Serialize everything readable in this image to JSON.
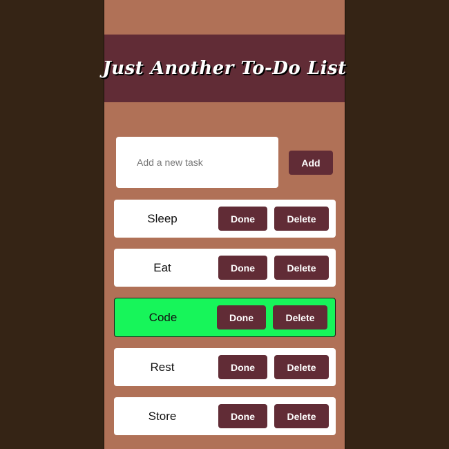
{
  "header": {
    "title": "Just Another To-Do List"
  },
  "new_task": {
    "placeholder": "Add a new task",
    "value": "",
    "add_label": "Add"
  },
  "todos": [
    {
      "text": "Sleep",
      "completed": false,
      "done_label": "Done",
      "delete_label": "Delete"
    },
    {
      "text": "Eat",
      "completed": false,
      "done_label": "Done",
      "delete_label": "Delete"
    },
    {
      "text": "Code",
      "completed": true,
      "done_label": "Done",
      "delete_label": "Delete"
    },
    {
      "text": "Rest",
      "completed": false,
      "done_label": "Done",
      "delete_label": "Delete"
    },
    {
      "text": "Store",
      "completed": false,
      "done_label": "Done",
      "delete_label": "Delete"
    }
  ],
  "colors": {
    "page_bg": "#352415",
    "panel_bg": "#b07157",
    "accent": "#612c36",
    "completed_bg": "#17f55a"
  }
}
